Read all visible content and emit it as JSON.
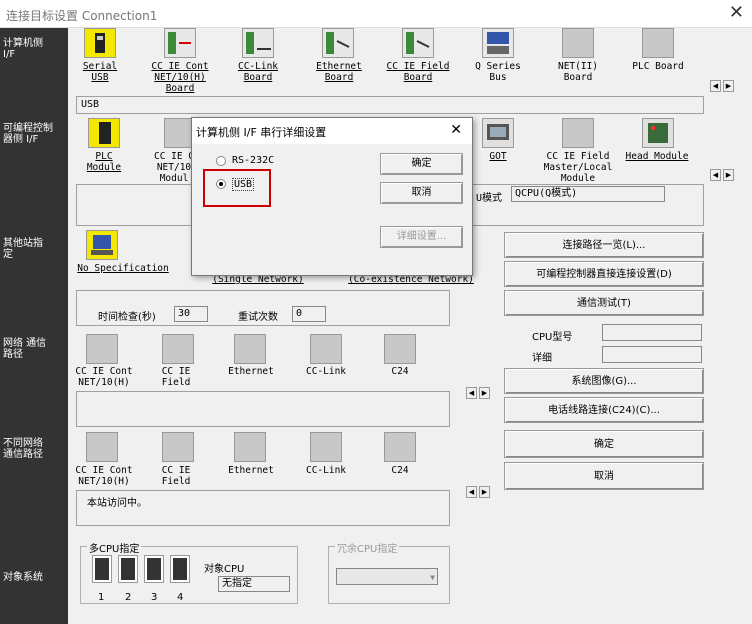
{
  "window": {
    "title": "连接目标设置 Connection1",
    "close": "✕"
  },
  "sidebar": [
    {
      "label": "计算机侧 I/F"
    },
    {
      "label": "可编程控制器侧 I/F"
    },
    {
      "label": "其他站指定"
    },
    {
      "label": "网络 通信路径"
    },
    {
      "label": "不同网络 通信路径"
    },
    {
      "label": "对象系统"
    }
  ],
  "pc_if": {
    "items": [
      "Serial USB",
      "CC IE Cont NET/10(H) Board",
      "CC-Link Board",
      "Ethernet Board",
      "CC IE Field Board",
      "Q Series Bus",
      "NET(II) Board",
      "PLC Board"
    ],
    "selected_text": "USB"
  },
  "plc_if": {
    "items": [
      "PLC Module",
      "CC IE C NET/10 Modul",
      "GOT",
      "CC IE Field Master/Local Module",
      "Head Module"
    ],
    "mode_label": "U模式",
    "mode_value": "QCPU(Q模式)"
  },
  "other_station": {
    "label": "No Specification",
    "single": "(Single Network)",
    "coexist": "(Co-existence Network)",
    "time_check_label": "时间检查(秒)",
    "time_check_value": "30",
    "retry_label": "重试次数",
    "retry_value": "0"
  },
  "network_route": {
    "items": [
      "CC IE Cont NET/10(H)",
      "CC IE Field",
      "Ethernet",
      "CC-Link",
      "C24"
    ]
  },
  "diff_network_route": {
    "items": [
      "CC IE Cont NET/10(H)",
      "CC IE Field",
      "Ethernet",
      "CC-Link",
      "C24"
    ],
    "status": "本站访问中。"
  },
  "right_buttons": {
    "route_list": "连接路径一览(L)...",
    "direct": "可编程控制器直接连接设置(D)",
    "comm_test": "通信测试(T)",
    "cpu_model_label": "CPU型号",
    "detail_label": "详细",
    "system_image": "系统图像(G)...",
    "phone_line": "电话线路连接(C24)(C)...",
    "ok": "确定",
    "cancel": "取消"
  },
  "target_system": {
    "multi_cpu": "多CPU指定",
    "cpu_numbers": [
      "1",
      "2",
      "3",
      "4"
    ],
    "target_cpu_label": "对象CPU",
    "target_cpu_value": "无指定",
    "redundant": "冗余CPU指定"
  },
  "dialog": {
    "title": "计算机侧 I/F 串行详细设置",
    "close": "✕",
    "radio1": "RS-232C",
    "radio2": "USB",
    "ok": "确定",
    "cancel": "取消",
    "detail": "详细设置..."
  },
  "colors": {
    "sidebar": "#333333",
    "highlight": "#cc0000",
    "icon_yellow": "#f2e800"
  }
}
